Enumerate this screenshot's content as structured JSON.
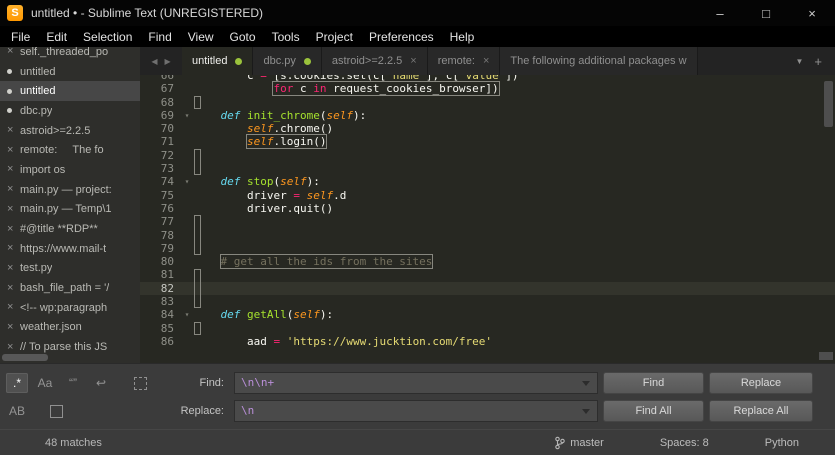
{
  "window": {
    "logo_letter": "S",
    "title": "untitled • - Sublime Text (UNREGISTERED)",
    "controls": {
      "minimize": "–",
      "maximize": "□",
      "close": "×"
    }
  },
  "menu": {
    "items": [
      "File",
      "Edit",
      "Selection",
      "Find",
      "View",
      "Goto",
      "Tools",
      "Project",
      "Preferences",
      "Help"
    ]
  },
  "sidebar": {
    "close_glyph": "×",
    "items": [
      {
        "label": "self._threaded_po",
        "glyph": "close"
      },
      {
        "label": "untitled",
        "glyph": "dot"
      },
      {
        "label": "untitled",
        "glyph": "dot",
        "selected": true
      },
      {
        "label": "dbc.py",
        "glyph": "dot"
      },
      {
        "label": "astroid>=2.2.5",
        "glyph": "close"
      },
      {
        "label": "remote:     The fo",
        "glyph": "close"
      },
      {
        "label": "import os",
        "glyph": "close"
      },
      {
        "label": "main.py — project:",
        "glyph": "close"
      },
      {
        "label": "main.py — Temp\\1",
        "glyph": "close"
      },
      {
        "label": "#@title **RDP**",
        "glyph": "close"
      },
      {
        "label": "https://www.mail-t",
        "glyph": "close"
      },
      {
        "label": "test.py",
        "glyph": "close"
      },
      {
        "label": "bash_file_path = '/",
        "glyph": "close"
      },
      {
        "label": "<!-- wp:paragraph",
        "glyph": "close"
      },
      {
        "label": "weather.json",
        "glyph": "close"
      },
      {
        "label": "// To parse this JS",
        "glyph": "close"
      }
    ]
  },
  "tabs": {
    "nav_left": "◀",
    "nav_right": "▶",
    "overflow_icon": "▼",
    "new_tab_icon": "+",
    "close_glyph": "×",
    "items": [
      {
        "label": "untitled",
        "indicator": "dot",
        "active": true
      },
      {
        "label": "dbc.py",
        "indicator": "dot"
      },
      {
        "label": "astroid>=2.2.5",
        "indicator": "close"
      },
      {
        "label": "remote:",
        "indicator": "close"
      },
      {
        "label": "The following additional packages w",
        "indicator": "none"
      }
    ]
  },
  "editor": {
    "first_line": 66,
    "cursor_line": 82,
    "fold_glyph": "▾",
    "fold_lines": [
      69,
      74,
      84
    ],
    "lines": [
      {
        "n": 66,
        "segs": [
          [
            "p",
            "        c "
          ],
          [
            "k",
            "="
          ],
          [
            "p",
            " [s.cookies.set(c["
          ],
          [
            "s",
            "'name'"
          ],
          [
            "p",
            "], c["
          ],
          [
            "s",
            "'value'"
          ],
          [
            "p",
            "])"
          ]
        ]
      },
      {
        "n": 67,
        "box_from": 1,
        "segs": [
          [
            "p",
            "            "
          ],
          [
            "k",
            "for"
          ],
          [
            "p",
            " c "
          ],
          [
            "k",
            "in"
          ],
          [
            "p",
            " request_cookies_browser])"
          ]
        ]
      },
      {
        "n": 68,
        "segs": []
      },
      {
        "n": 69,
        "segs": [
          [
            "p",
            "    "
          ],
          [
            "st",
            "def"
          ],
          [
            "p",
            " "
          ],
          [
            "fn",
            "init_chrome"
          ],
          [
            "p",
            "("
          ],
          [
            "sf",
            "self"
          ],
          [
            "p",
            "):"
          ]
        ]
      },
      {
        "n": 70,
        "segs": [
          [
            "p",
            "        "
          ],
          [
            "sf",
            "self"
          ],
          [
            "p",
            ".chrome()"
          ]
        ]
      },
      {
        "n": 71,
        "box_from": 1,
        "segs": [
          [
            "p",
            "        "
          ],
          [
            "sf",
            "self"
          ],
          [
            "p",
            ".login()"
          ]
        ]
      },
      {
        "n": 72,
        "segs": []
      },
      {
        "n": 73,
        "segs": []
      },
      {
        "n": 74,
        "segs": [
          [
            "p",
            "    "
          ],
          [
            "st",
            "def"
          ],
          [
            "p",
            " "
          ],
          [
            "fn",
            "stop"
          ],
          [
            "p",
            "("
          ],
          [
            "sf",
            "self"
          ],
          [
            "p",
            "):"
          ]
        ]
      },
      {
        "n": 75,
        "segs": [
          [
            "p",
            "        driver "
          ],
          [
            "k",
            "="
          ],
          [
            "p",
            " "
          ],
          [
            "sf",
            "self"
          ],
          [
            "p",
            ".d"
          ]
        ]
      },
      {
        "n": 76,
        "segs": [
          [
            "p",
            "        driver.quit()"
          ]
        ]
      },
      {
        "n": 77,
        "segs": []
      },
      {
        "n": 78,
        "segs": []
      },
      {
        "n": 79,
        "segs": []
      },
      {
        "n": 80,
        "box_from": 1,
        "segs": [
          [
            "p",
            "    "
          ],
          [
            "cm",
            "# get all the ids from the sites"
          ]
        ]
      },
      {
        "n": 81,
        "segs": []
      },
      {
        "n": 82,
        "segs": []
      },
      {
        "n": 83,
        "segs": []
      },
      {
        "n": 84,
        "segs": [
          [
            "p",
            "    "
          ],
          [
            "st",
            "def"
          ],
          [
            "p",
            " "
          ],
          [
            "fn",
            "getAll"
          ],
          [
            "p",
            "("
          ],
          [
            "sf",
            "self"
          ],
          [
            "p",
            "):"
          ]
        ]
      },
      {
        "n": 85,
        "segs": []
      },
      {
        "n": 86,
        "segs": [
          [
            "p",
            "        aad "
          ],
          [
            "k",
            "="
          ],
          [
            "p",
            " "
          ],
          [
            "s",
            "'https://www.jucktion.com/free'"
          ]
        ]
      }
    ],
    "blank_match_boxes": [
      {
        "line": 68,
        "rows": 1
      },
      {
        "line": 72,
        "rows": 2
      },
      {
        "line": 77,
        "rows": 3
      },
      {
        "line": 81,
        "rows": 3
      },
      {
        "line": 85,
        "rows": 1
      }
    ]
  },
  "find_panel": {
    "toggles": {
      "regex": ".*",
      "case": "Aa",
      "wholeword": "“”",
      "wrap": "↩",
      "preserve_case": "AB"
    },
    "find_label": "Find:",
    "replace_label": "Replace:",
    "find_value": "\\n\\n+",
    "replace_value": "\\n",
    "buttons": {
      "find": "Find",
      "replace": "Replace",
      "find_all": "Find All",
      "replace_all": "Replace All"
    }
  },
  "status_bar": {
    "matches": "48 matches",
    "branch": "master",
    "spaces": "Spaces: 8",
    "syntax": "Python"
  },
  "colors": {
    "logo_orange": "#ff9800",
    "modified_dot_green": "#9bc33c",
    "find_value_purple": "#b98fd8"
  }
}
